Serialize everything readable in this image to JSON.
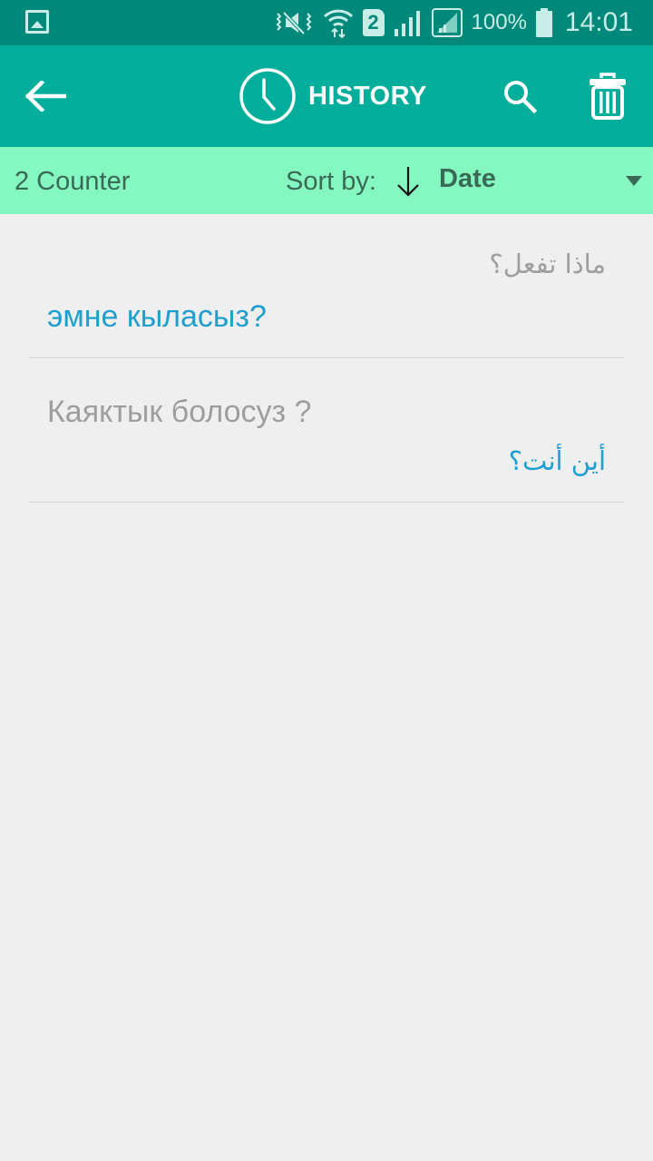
{
  "status_bar": {
    "icons": [
      "gallery-icon",
      "vibrate-mute-icon",
      "wifi-icon",
      "sim-2-icon",
      "signal-icon",
      "signal-icon-2",
      "battery-icon"
    ],
    "sim_label": "2",
    "battery_percent": "100%",
    "time": "14:01"
  },
  "app_bar": {
    "back_icon": "arrow-left-icon",
    "title_icon": "clock-icon",
    "title": "HISTORY",
    "search_icon": "search-icon",
    "delete_icon": "trash-icon"
  },
  "sort_bar": {
    "counter": "2 Counter",
    "sort_label": "Sort by:",
    "sort_direction_icon": "arrow-down-icon",
    "sort_value": "Date",
    "dropdown_icon": "dropdown-triangle-icon"
  },
  "history": [
    {
      "source": "ماذا تفعل؟",
      "translation": "эмне кыласыз?"
    },
    {
      "source": "Каяктык болосуз ?",
      "translation": "أين أنت؟"
    }
  ],
  "colors": {
    "status_bar": "#00897b",
    "app_bar": "#00ae9b",
    "sort_bar": "#85f8c1",
    "background": "#efefef",
    "accent_text": "#1f9fcf",
    "muted_text": "#9e9e9e"
  }
}
